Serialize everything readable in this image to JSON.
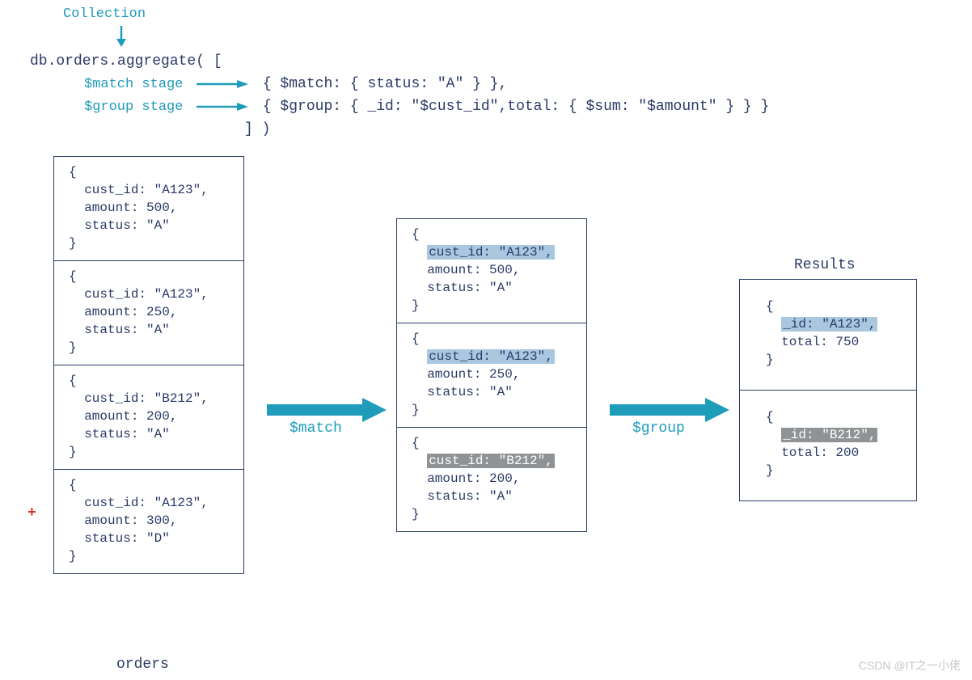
{
  "header": {
    "collection_label": "Collection",
    "line1": "db.orders.aggregate( [",
    "match_label": "$match stage",
    "match_code": "{ $match: { status: \"A\" } },",
    "group_label": "$group stage",
    "group_code": "{ $group: { _id: \"$cust_id\",total: { $sum: \"$amount\" } } }",
    "line_end": "] )"
  },
  "orders_label": "orders",
  "results_label": "Results",
  "arrow1_label": "$match",
  "arrow2_label": "$group",
  "red_plus": "+",
  "watermark": "CSDN @IT之一小佬",
  "orders": [
    {
      "open": "{",
      "l1": "  cust_id: \"A123\",",
      "l2": "  amount: 500,",
      "l3": "  status: \"A\"",
      "close": "}"
    },
    {
      "open": "{",
      "l1": "  cust_id: \"A123\",",
      "l2": "  amount: 250,",
      "l3": "  status: \"A\"",
      "close": "}"
    },
    {
      "open": "{",
      "l1": "  cust_id: \"B212\",",
      "l2": "  amount: 200,",
      "l3": "  status: \"A\"",
      "close": "}"
    },
    {
      "open": "{",
      "l1": "  cust_id: \"A123\",",
      "l2": "  amount: 300,",
      "l3": "  status: \"D\"",
      "close": "}"
    }
  ],
  "matched": [
    {
      "open": "{",
      "pre": "  ",
      "hl": "cust_id: \"A123\",",
      "l2": "  amount: 500,",
      "l3": "  status: \"A\"",
      "close": "}",
      "hlclass": "hl-blue"
    },
    {
      "open": "{",
      "pre": "  ",
      "hl": "cust_id: \"A123\",",
      "l2": "  amount: 250,",
      "l3": "  status: \"A\"",
      "close": "}",
      "hlclass": "hl-blue"
    },
    {
      "open": "{",
      "pre": "  ",
      "hl": "cust_id: \"B212\",",
      "l2": "  amount: 200,",
      "l3": "  status: \"A\"",
      "close": "}",
      "hlclass": "hl-gray"
    }
  ],
  "results": [
    {
      "open": "{",
      "pre": "  ",
      "hl": "_id: \"A123\",",
      "l2": "  total: 750",
      "close": "}",
      "hlclass": "hl-blue"
    },
    {
      "open": "{",
      "pre": "  ",
      "hl": "_id: \"B212\",",
      "l2": "  total: 200",
      "close": "}",
      "hlclass": "hl-gray"
    }
  ]
}
